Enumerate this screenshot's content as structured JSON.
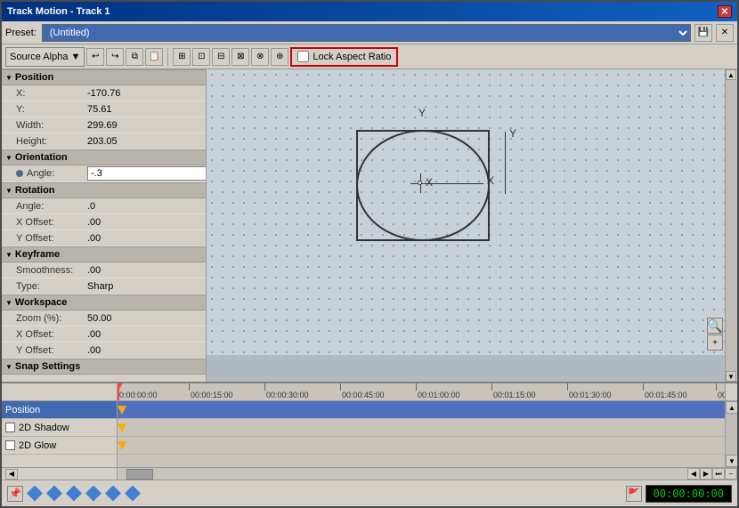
{
  "window": {
    "title": "Track Motion - Track 1"
  },
  "preset": {
    "label": "Preset:",
    "value": "(Untitled)"
  },
  "toolbar": {
    "source_alpha_label": "Source Alpha",
    "lock_aspect_label": "Lock Aspect Ratio"
  },
  "properties": {
    "position_header": "Position",
    "position": {
      "x_label": "X:",
      "x_value": "-170.76",
      "y_label": "Y:",
      "y_value": "75.61",
      "width_label": "Width:",
      "width_value": "299.69",
      "height_label": "Height:",
      "height_value": "203.05"
    },
    "orientation_header": "Orientation",
    "orientation": {
      "angle_label": "Angle:",
      "angle_value": "-.3"
    },
    "rotation_header": "Rotation",
    "rotation": {
      "angle_label": "Angle:",
      "angle_value": ".0",
      "x_offset_label": "X Offset:",
      "x_offset_value": ".00",
      "y_offset_label": "Y Offset:",
      "y_offset_value": ".00"
    },
    "keyframe_header": "Keyframe",
    "keyframe": {
      "smoothness_label": "Smoothness:",
      "smoothness_value": ".00",
      "type_label": "Type:",
      "type_value": "Sharp"
    },
    "workspace_header": "Workspace",
    "workspace": {
      "zoom_label": "Zoom (%):",
      "zoom_value": "50.00",
      "x_offset_label": "X Offset:",
      "x_offset_value": ".00",
      "y_offset_label": "Y Offset:",
      "y_offset_value": ".00"
    },
    "snap_header": "Snap Settings"
  },
  "ruler": {
    "marks": [
      "00:00:00:00",
      "00:00:15:00",
      "00:00:30:00",
      "00:00:45:00",
      "00:01:00:00",
      "00:01:15:00",
      "00:01:30:00",
      "00:01:45:00",
      "00:"
    ]
  },
  "tracks": [
    {
      "label": "Position",
      "color": "blue",
      "has_keyframe": true
    },
    {
      "label": "2D Shadow",
      "color": "normal",
      "has_keyframe": true
    },
    {
      "label": "2D Glow",
      "color": "normal",
      "has_keyframe": true
    }
  ],
  "timeline": {
    "time_display": "00:00:00:00"
  },
  "bottom_icons": {
    "icon1": "◆",
    "icon2": "◆",
    "icon3": "◆",
    "icon4": "◆",
    "icon5": "◆",
    "icon6": "◆"
  }
}
